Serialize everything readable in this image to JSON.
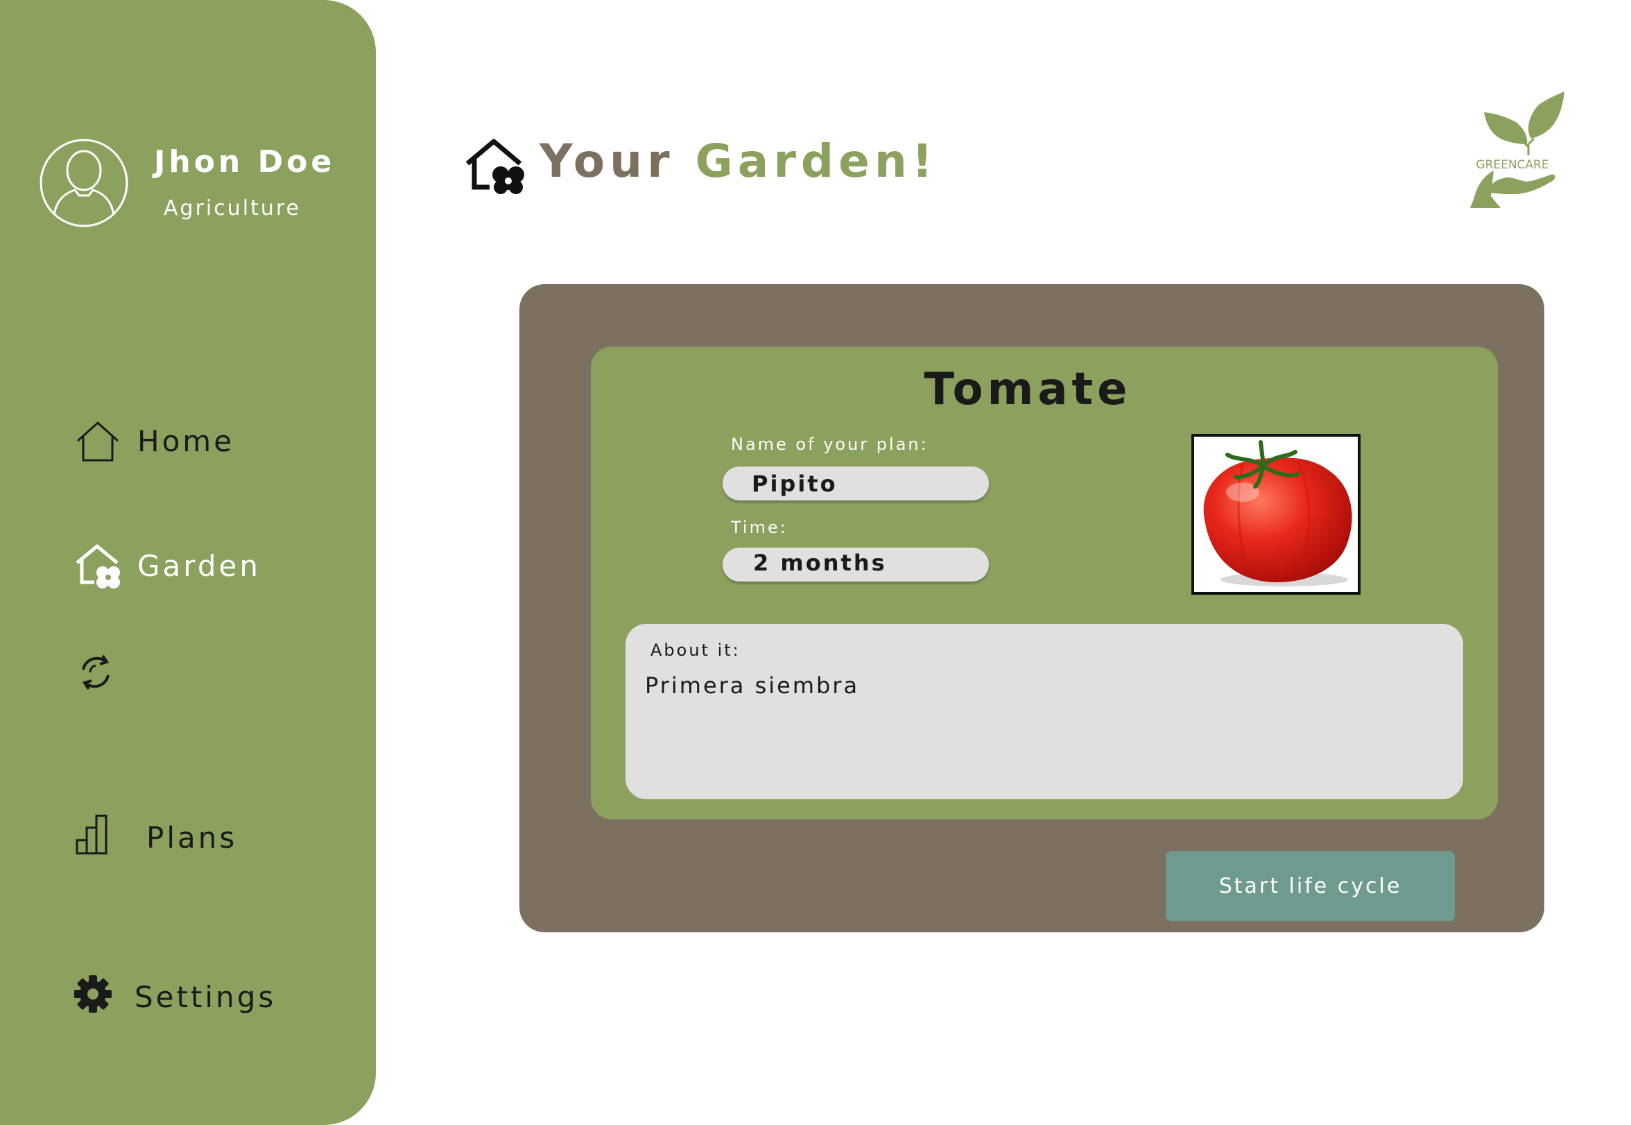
{
  "theme": {
    "sidebar_bg": "#8ba15d",
    "card_bg": "#7c7061",
    "inner_card_bg": "#8ba15d",
    "field_bg": "#e0e0e0",
    "button_bg": "#6e9a8f",
    "title_brown": "#7c7061",
    "title_green": "#8ba15d"
  },
  "user": {
    "name": "Jhon Doe",
    "role": "Agriculture",
    "avatar_icon": "user-avatar-icon"
  },
  "sidebar": {
    "items": [
      {
        "label": "Home",
        "icon": "home-icon"
      },
      {
        "label": "Garden",
        "icon": "garden-house-icon"
      },
      {
        "label": "",
        "icon": "refresh-cycle-icon"
      },
      {
        "label": "Plans",
        "icon": "bar-chart-icon"
      },
      {
        "label": "Settings",
        "icon": "gear-icon"
      }
    ]
  },
  "header": {
    "title_part1": "Your",
    "title_part2": "Garden!",
    "icon": "garden-house-icon",
    "logo_text": "GREENCARE"
  },
  "plan": {
    "plant_name": "Tomate",
    "name_label": "Name of your plan:",
    "name_value": "Pipito",
    "time_label": "Time:",
    "time_value": "2 months",
    "image_icon": "tomato-image",
    "about_label": "About it:",
    "about_text": "Primera siembra",
    "action_label": "Start life cycle"
  }
}
